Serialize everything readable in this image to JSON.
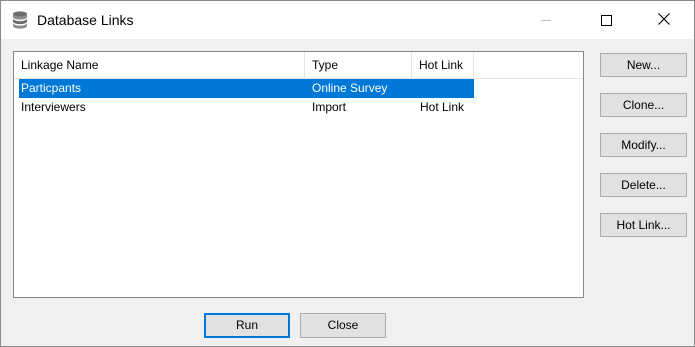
{
  "window": {
    "title": "Database Links",
    "icon": "database-icon",
    "controls": {
      "minimize": "minimize-icon",
      "maximize": "maximize-icon",
      "close": "close-icon"
    }
  },
  "list": {
    "columns": {
      "name": "Linkage Name",
      "type": "Type",
      "hot_link": "Hot Link"
    },
    "rows": [
      {
        "name": "Particpants",
        "type": "Online Survey",
        "hot_link": "",
        "selected": true
      },
      {
        "name": "Interviewers",
        "type": "Import",
        "hot_link": "Hot Link",
        "selected": false
      }
    ]
  },
  "side_buttons": {
    "new": "New...",
    "clone": "Clone...",
    "modify": "Modify...",
    "delete": "Delete...",
    "hot_link": "Hot Link..."
  },
  "bottom_buttons": {
    "run": "Run",
    "close": "Close"
  },
  "colors": {
    "selection": "#0078d7",
    "button_face": "#e1e1e1",
    "dialog_bg": "#f0f0f0"
  }
}
